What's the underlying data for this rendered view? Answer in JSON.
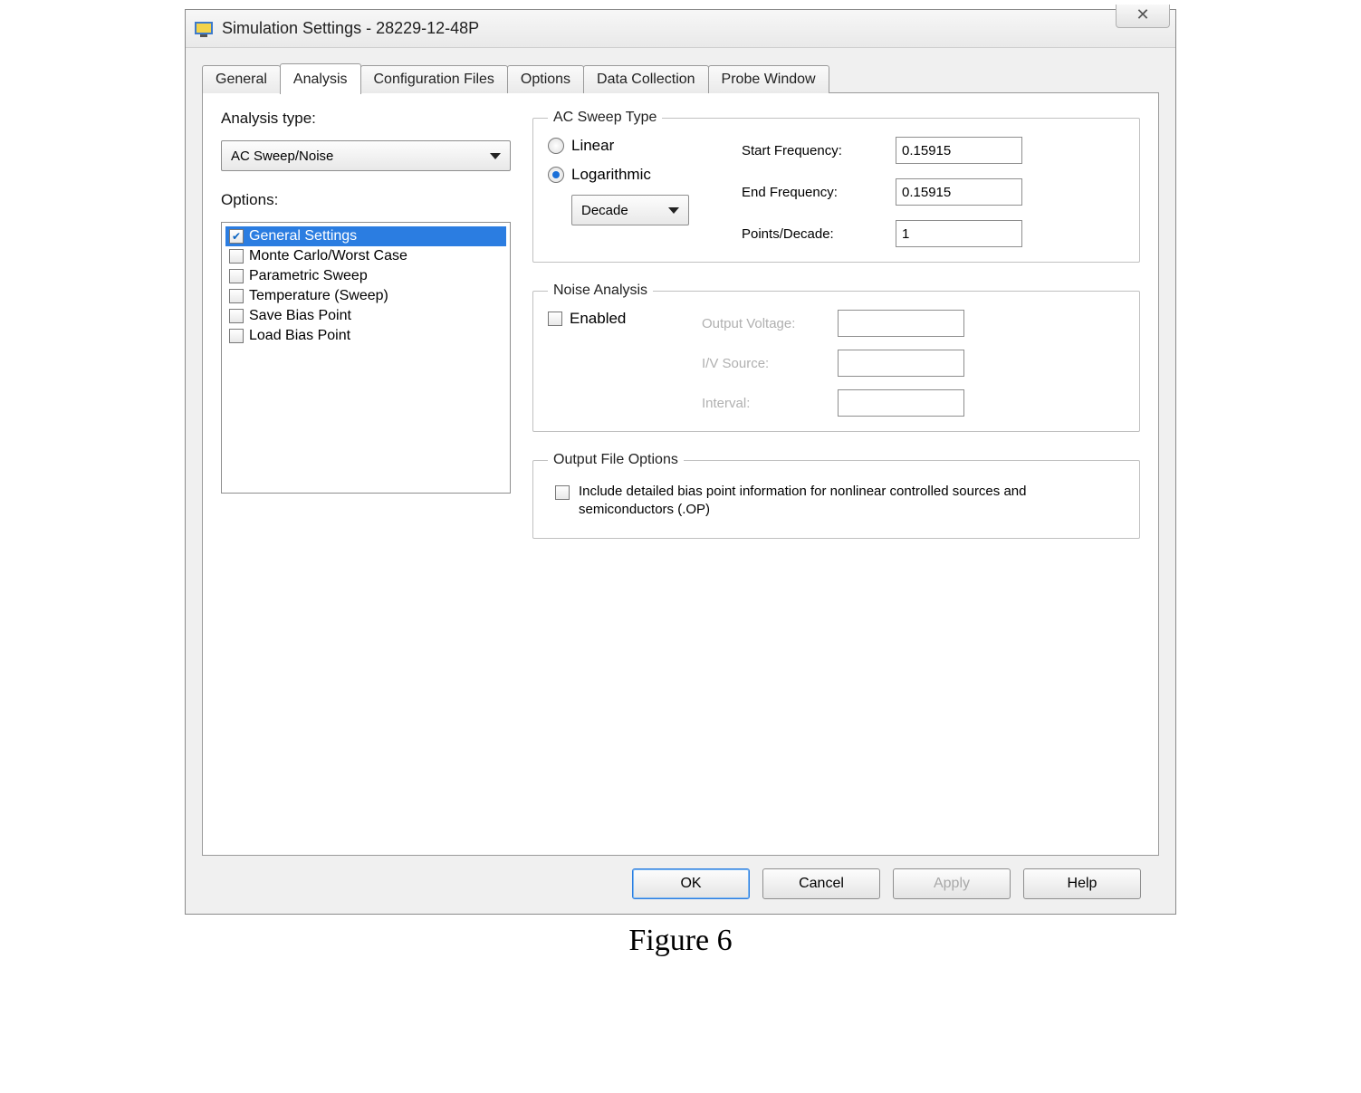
{
  "window": {
    "title": "Simulation Settings - 28229-12-48P",
    "close_glyph": "✕"
  },
  "tabs": [
    "General",
    "Analysis",
    "Configuration Files",
    "Options",
    "Data Collection",
    "Probe Window"
  ],
  "active_tab": "Analysis",
  "left": {
    "analysis_type_label": "Analysis type:",
    "analysis_type_value": "AC Sweep/Noise",
    "options_label": "Options:",
    "options": [
      {
        "label": "General Settings",
        "checked": true,
        "selected": true
      },
      {
        "label": "Monte Carlo/Worst Case",
        "checked": false,
        "selected": false
      },
      {
        "label": "Parametric Sweep",
        "checked": false,
        "selected": false
      },
      {
        "label": "Temperature (Sweep)",
        "checked": false,
        "selected": false
      },
      {
        "label": "Save Bias Point",
        "checked": false,
        "selected": false
      },
      {
        "label": "Load Bias Point",
        "checked": false,
        "selected": false
      }
    ]
  },
  "ac_sweep": {
    "legend": "AC Sweep Type",
    "linear_label": "Linear",
    "log_label": "Logarithmic",
    "log_selected": true,
    "scale_value": "Decade",
    "start_freq_label": "Start Frequency:",
    "start_freq_value": "0.15915",
    "end_freq_label": "End Frequency:",
    "end_freq_value": "0.15915",
    "points_label": "Points/Decade:",
    "points_value": "1"
  },
  "noise": {
    "legend": "Noise Analysis",
    "enabled_label": "Enabled",
    "enabled_checked": false,
    "output_voltage_label": "Output Voltage:",
    "iv_source_label": "I/V Source:",
    "interval_label": "Interval:"
  },
  "output_file": {
    "legend": "Output File Options",
    "checkbox_label": "Include detailed bias point information for nonlinear controlled sources and semiconductors (.OP)",
    "checked": false
  },
  "buttons": {
    "ok": "OK",
    "cancel": "Cancel",
    "apply": "Apply",
    "help": "Help"
  },
  "caption": "Figure 6"
}
